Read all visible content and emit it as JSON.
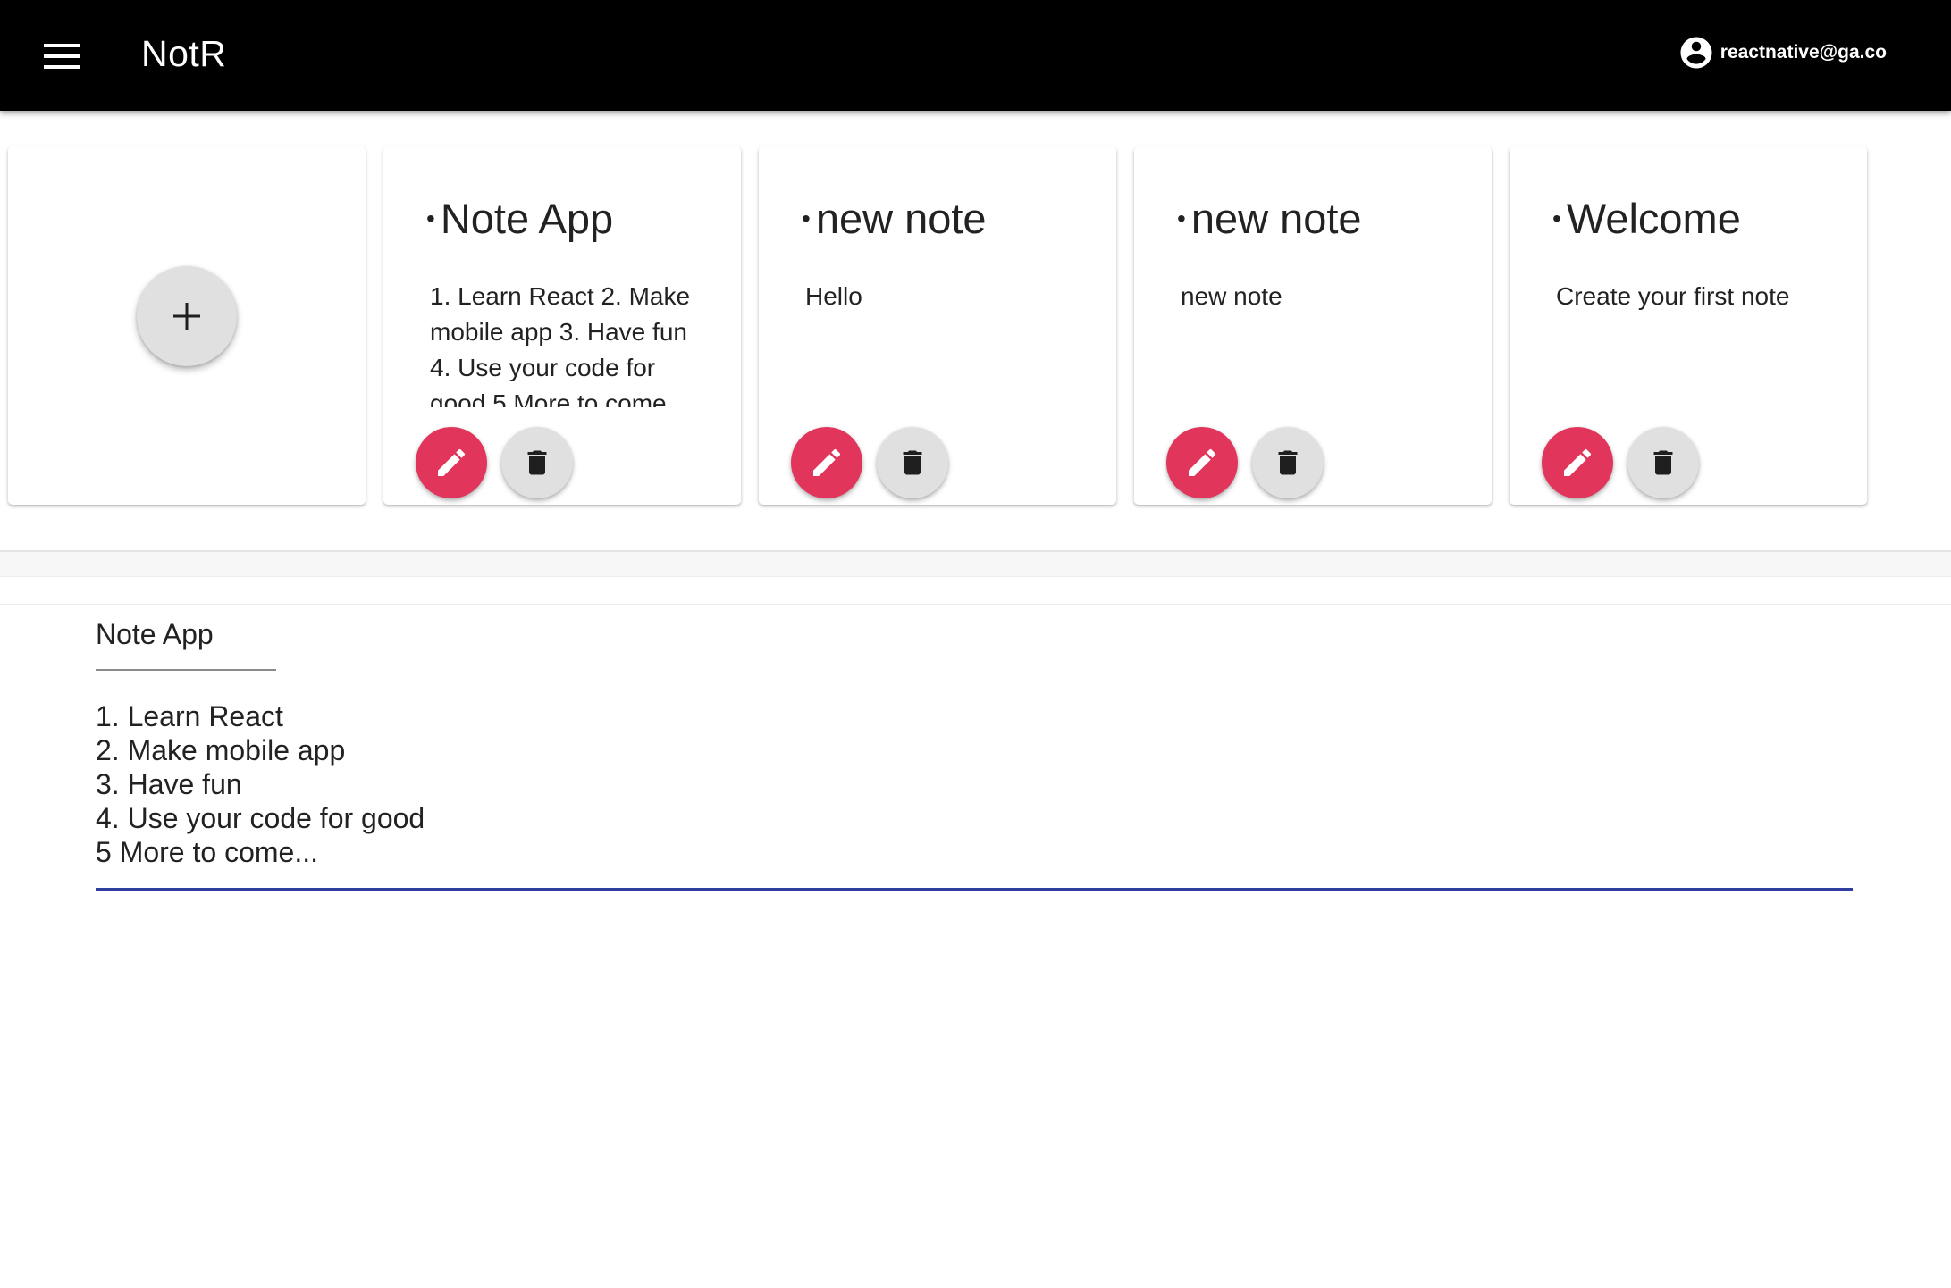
{
  "appbar": {
    "title": "NotR",
    "menu_icon": "menu-icon",
    "account_icon": "account-circle-icon",
    "account_email": "reactnative@ga.co"
  },
  "add_card": {
    "icon": "plus-icon"
  },
  "notes": [
    {
      "bullet": "•",
      "title": "Note App",
      "body": "1. Learn React 2. Make mobile app 3. Have fun 4. Use your code for good 5 More to come..."
    },
    {
      "bullet": "•",
      "title": "new note",
      "body": "Hello"
    },
    {
      "bullet": "•",
      "title": "new note",
      "body": "new note"
    },
    {
      "bullet": "•",
      "title": "Welcome",
      "body": "Create your first note"
    }
  ],
  "card_actions": {
    "edit_icon": "pencil-icon",
    "delete_icon": "trash-icon"
  },
  "editor": {
    "title_value": "Note App",
    "body_value": "1. Learn React\n2. Make mobile app\n3. Have fun\n4. Use your code for good\n5 More to come..."
  },
  "colors": {
    "appbar": "#000000",
    "edit_fab": "#e1355b",
    "neutral_fab": "#e0e0e0",
    "focus_underline": "#303f9f"
  }
}
